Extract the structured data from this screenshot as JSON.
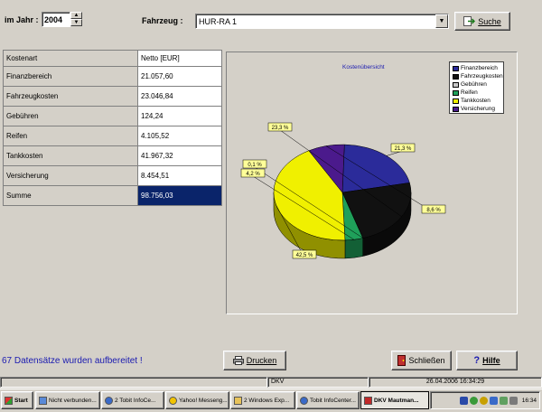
{
  "filters": {
    "year_label": "im Jahr :",
    "year_value": "2004",
    "vehicle_label": "Fahrzeug :",
    "vehicle_value": "HUR-RA 1",
    "search_label": "Suche"
  },
  "table": {
    "headers": [
      "Kostenart",
      "Netto [EUR]"
    ],
    "rows": [
      {
        "name": "Finanzbereich",
        "value": "21.057,60"
      },
      {
        "name": "Fahrzeugkosten",
        "value": "23.046,84"
      },
      {
        "name": "Gebühren",
        "value": "124,24"
      },
      {
        "name": "Reifen",
        "value": "4.105,52"
      },
      {
        "name": "Tankkosten",
        "value": "41.967,32"
      },
      {
        "name": "Versicherung",
        "value": "8.454,51"
      }
    ],
    "sum_label": "Summe",
    "sum_value": "98.756,03"
  },
  "chart_data": {
    "type": "pie",
    "title": "Kostenübersicht",
    "legend_position": "top-right",
    "slices": [
      {
        "name": "Finanzbereich",
        "percent": 21.3,
        "label": "21,3 %",
        "color": "#2b2b9a"
      },
      {
        "name": "Fahrzeugkosten",
        "percent": 23.3,
        "label": "23,3 %",
        "color": "#111111"
      },
      {
        "name": "Gebühren",
        "percent": 0.1,
        "label": "0,1 %",
        "color": "#c8c8c8"
      },
      {
        "name": "Reifen",
        "percent": 4.2,
        "label": "4,2 %",
        "color": "#1fa05a"
      },
      {
        "name": "Tankkosten",
        "percent": 42.5,
        "label": "42,5 %",
        "color": "#f0f000"
      },
      {
        "name": "Versicherung",
        "percent": 8.6,
        "label": "8,6 %",
        "color": "#4b1a8c"
      }
    ]
  },
  "footer": {
    "status_message": "67 Datensätze wurden aufbereitet !",
    "print_label": "Drucken",
    "close_label": "Schließen",
    "help_label": "Hilfe"
  },
  "statusbar": {
    "app_code": "DKV",
    "datetime": "26.04.2006 16:34:29"
  },
  "taskbar": {
    "start_label": "Start",
    "tasks": [
      "Nicht verbunden...",
      "2 Tobit InfoCe...",
      "Yahoo! Messeng...",
      "2 Windows Exp...",
      "Tobit InfoCenter...",
      "DKV Mautman..."
    ],
    "clock": "16:34"
  },
  "colors": {
    "window_bg": "#d4d0c8",
    "selection": "#0a246a",
    "status_text": "#1a1ab0"
  }
}
